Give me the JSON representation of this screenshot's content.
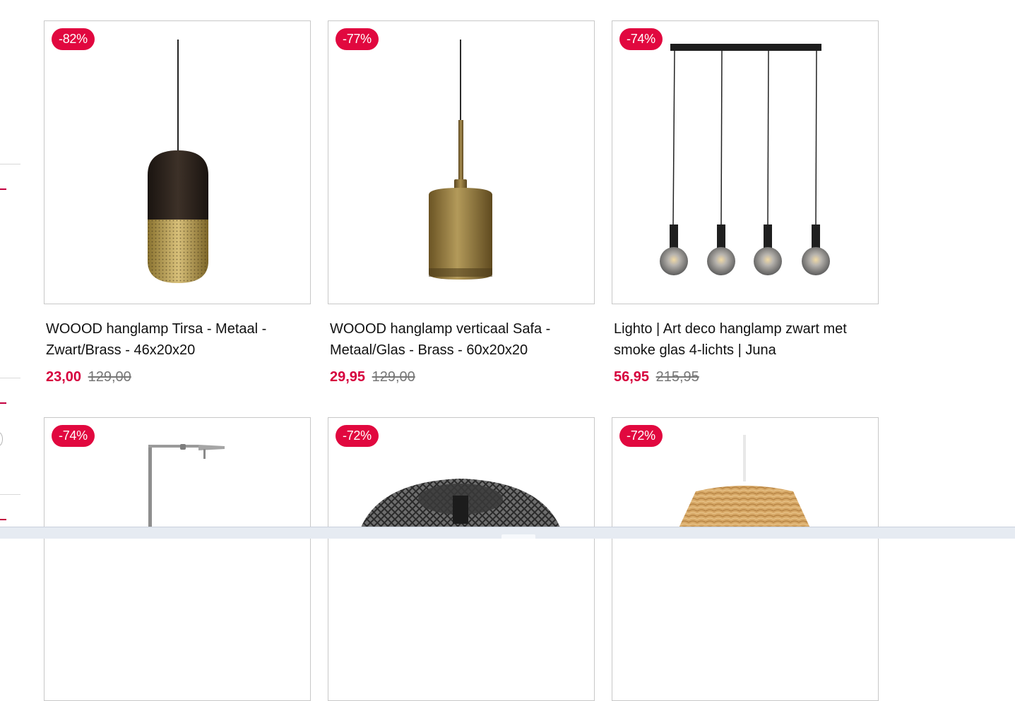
{
  "products": [
    {
      "badge": "-82%",
      "title_line1": "WOOOD hanglamp Tirsa - Metaal -",
      "title_line2": "Zwart/Brass - 46x20x20",
      "price_new": "23,00",
      "price_old": "129,00"
    },
    {
      "badge": "-77%",
      "title_line1": "WOOOD hanglamp verticaal Safa -",
      "title_line2": "Metaal/Glas - Brass - 60x20x20",
      "price_new": "29,95",
      "price_old": "129,00"
    },
    {
      "badge": "-74%",
      "title_line1": "Lighto | Art deco hanglamp zwart met",
      "title_line2": "smoke glas 4-lichts | Juna",
      "price_new": "56,95",
      "price_old": "215,95"
    },
    {
      "badge": "-74%"
    },
    {
      "badge": "-72%"
    },
    {
      "badge": "-72%"
    }
  ],
  "colors": {
    "badge_bg": "#e1083f",
    "price_new": "#d6003d",
    "price_old": "#777777",
    "border": "#c8c8c8"
  }
}
